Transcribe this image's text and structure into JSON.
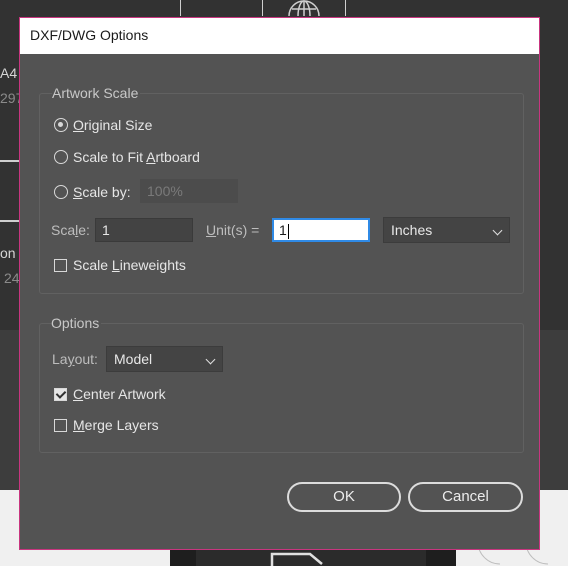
{
  "dialog": {
    "title": "DXF/DWG Options"
  },
  "background": {
    "side_texts": [
      "A4",
      "297",
      "on",
      "24"
    ]
  },
  "artwork_scale": {
    "label": "Artwork Scale",
    "original_size": {
      "label": "Original Size",
      "selected": true
    },
    "scale_to_fit": {
      "label": "Scale to Fit Artboard",
      "selected": false
    },
    "scale_by": {
      "label": "Scale by:",
      "selected": false,
      "value": "100%"
    },
    "scale": {
      "label": "Scale:",
      "value": "1"
    },
    "units": {
      "label": "Unit(s) =",
      "value": "1"
    },
    "unit_select": {
      "value": "Inches"
    },
    "scale_lineweights": {
      "label": "Scale Lineweights",
      "checked": false
    }
  },
  "options": {
    "label": "Options",
    "layout": {
      "label": "Layout:",
      "value": "Model"
    },
    "center_artwork": {
      "label": "Center Artwork",
      "checked": true
    },
    "merge_layers": {
      "label": "Merge Layers",
      "checked": false
    }
  },
  "buttons": {
    "ok": "OK",
    "cancel": "Cancel"
  },
  "colors": {
    "dialog_bg": "#535353",
    "dialog_border": "#c8357f",
    "focus_ring": "#2f8ae6"
  },
  "icons": [
    "globe-icon",
    "radio-icon",
    "checkbox-icon",
    "chevron-down-icon",
    "document-icon"
  ]
}
